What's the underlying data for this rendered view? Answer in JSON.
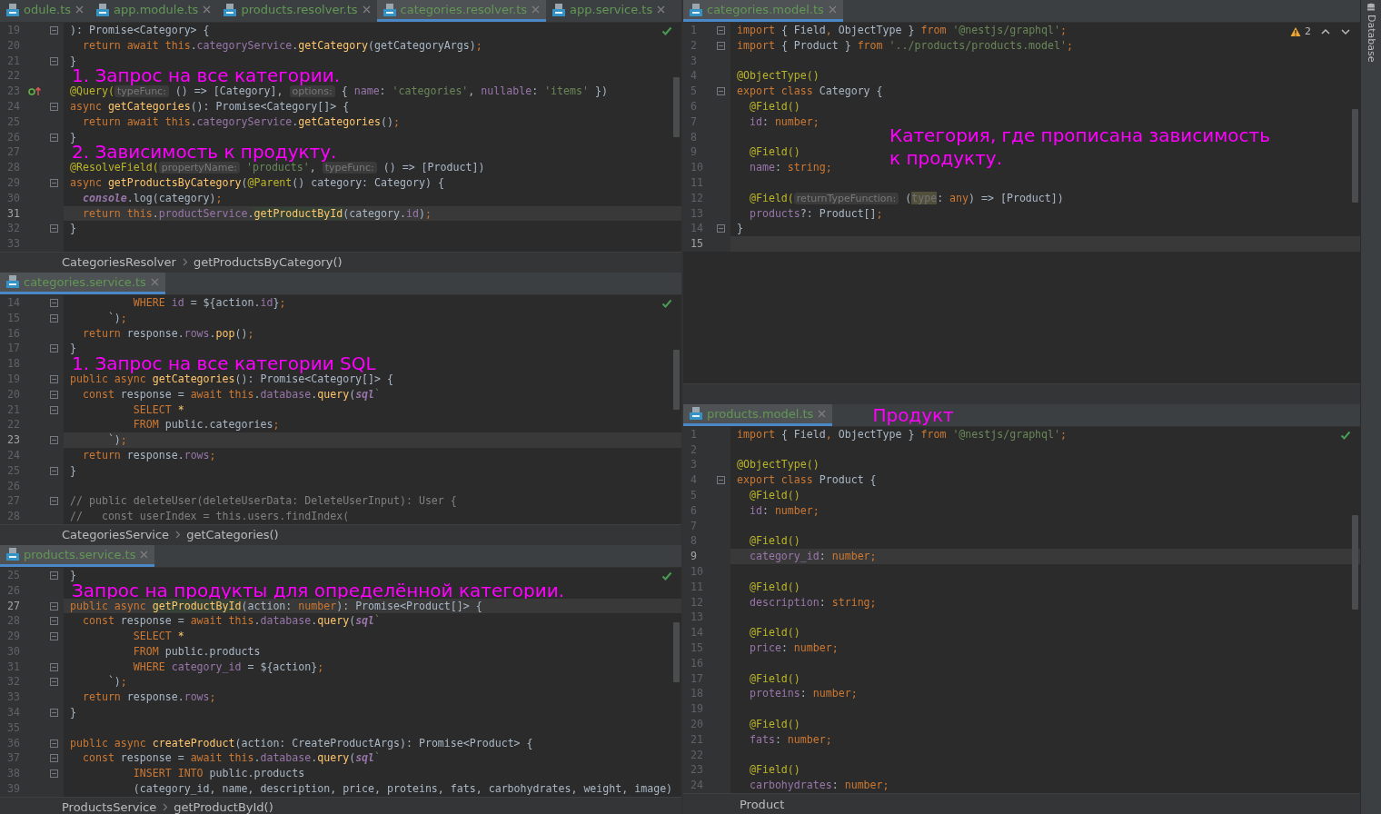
{
  "left_panes": [
    {
      "tabs": [
        {
          "label": "odule.ts",
          "selected": false
        },
        {
          "label": "app.module.ts",
          "selected": false
        },
        {
          "label": "products.resolver.ts",
          "selected": false
        },
        {
          "label": "categories.resolver.ts",
          "selected": true
        },
        {
          "label": "app.service.ts",
          "selected": false
        }
      ],
      "inspection": {
        "kind": "ok"
      },
      "lines": [
        {
          "number": "19",
          "fold": true,
          "current": false,
          "tokens": [
            {
              "text": "): Promise<Category> {",
              "kind": "t"
            }
          ]
        },
        {
          "number": "20",
          "fold": false,
          "current": false,
          "tokens": [
            {
              "text": "  return await this",
              "kind": "k"
            },
            {
              "text": ".",
              "kind": "t"
            },
            {
              "text": "categoryService",
              "kind": "p"
            },
            {
              "text": ".",
              "kind": "t"
            },
            {
              "text": "getCategory",
              "kind": "f"
            },
            {
              "text": "(getCategoryArgs)",
              "kind": "t"
            },
            {
              "text": ";",
              "kind": "k"
            }
          ]
        },
        {
          "number": "21",
          "fold": true,
          "current": false,
          "tokens": [
            {
              "text": "}",
              "kind": "t"
            }
          ]
        },
        {
          "number": "22",
          "fold": false,
          "current": false,
          "note": {
            "text": "1. Запрос на все категории.",
            "kind": "inline"
          }
        },
        {
          "number": "23",
          "fold": false,
          "current": false,
          "gutter_icon": {
            "kind": "implements"
          },
          "tokens": [
            {
              "text": "@Query(",
              "kind": "a"
            },
            {
              "text": "typeFunc:",
              "kind": "h"
            },
            {
              "text": " () => [Category], ",
              "kind": "t"
            },
            {
              "text": "options:",
              "kind": "h"
            },
            {
              "text": " { ",
              "kind": "t"
            },
            {
              "text": "name",
              "kind": "p"
            },
            {
              "text": ": ",
              "kind": "t"
            },
            {
              "text": "'categories'",
              "kind": "s"
            },
            {
              "text": ", ",
              "kind": "t"
            },
            {
              "text": "nullable",
              "kind": "p"
            },
            {
              "text": ": ",
              "kind": "t"
            },
            {
              "text": "'items'",
              "kind": "s"
            },
            {
              "text": " })",
              "kind": "t"
            }
          ]
        },
        {
          "number": "24",
          "fold": true,
          "current": false,
          "tokens": [
            {
              "text": "async ",
              "kind": "k"
            },
            {
              "text": "getCategories",
              "kind": "f"
            },
            {
              "text": "(): Promise<Category[]> {",
              "kind": "t"
            }
          ]
        },
        {
          "number": "25",
          "fold": false,
          "current": false,
          "tokens": [
            {
              "text": "  return await this",
              "kind": "k"
            },
            {
              "text": ".",
              "kind": "t"
            },
            {
              "text": "categoryService",
              "kind": "p"
            },
            {
              "text": ".",
              "kind": "t"
            },
            {
              "text": "getCategories",
              "kind": "f"
            },
            {
              "text": "()",
              "kind": "t"
            },
            {
              "text": ";",
              "kind": "k"
            }
          ]
        },
        {
          "number": "26",
          "fold": true,
          "current": false,
          "tokens": [
            {
              "text": "}",
              "kind": "t"
            }
          ]
        },
        {
          "number": "27",
          "fold": false,
          "current": false,
          "note": {
            "text": "2. Зависимость к продукту.",
            "kind": "inline"
          }
        },
        {
          "number": "28",
          "fold": false,
          "current": false,
          "tokens": [
            {
              "text": "@ResolveField(",
              "kind": "a"
            },
            {
              "text": "propertyName:",
              "kind": "h"
            },
            {
              "text": " 'products'",
              "kind": "s"
            },
            {
              "text": ", ",
              "kind": "t"
            },
            {
              "text": "typeFunc:",
              "kind": "h"
            },
            {
              "text": " () => [Product])",
              "kind": "t"
            }
          ]
        },
        {
          "number": "29",
          "fold": true,
          "current": false,
          "tokens": [
            {
              "text": "async ",
              "kind": "k"
            },
            {
              "text": "getProductsByCategory",
              "kind": "f"
            },
            {
              "text": "(",
              "kind": "t"
            },
            {
              "text": "@Parent",
              "kind": "a"
            },
            {
              "text": "() category: Category) {",
              "kind": "t"
            }
          ]
        },
        {
          "number": "30",
          "fold": false,
          "current": false,
          "tokens": [
            {
              "text": "  console",
              "kind": "i"
            },
            {
              "text": ".log(category)",
              "kind": "t"
            },
            {
              "text": ";",
              "kind": "k"
            }
          ]
        },
        {
          "number": "31",
          "fold": false,
          "current": true,
          "tokens": [
            {
              "text": "  return this",
              "kind": "k"
            },
            {
              "text": ".",
              "kind": "t"
            },
            {
              "text": "productService",
              "kind": "p"
            },
            {
              "text": ".",
              "kind": "t"
            },
            {
              "text": "getProductById",
              "kind": "m"
            },
            {
              "text": "(category.",
              "kind": "t"
            },
            {
              "text": "id",
              "kind": "p"
            },
            {
              "text": ")",
              "kind": "t"
            },
            {
              "text": ";",
              "kind": "k"
            }
          ]
        },
        {
          "number": "32",
          "fold": true,
          "current": false,
          "tokens": [
            {
              "text": "}",
              "kind": "t"
            }
          ]
        },
        {
          "number": "33",
          "fold": false,
          "current": false
        }
      ],
      "breadcrumbs": [
        "CategoriesResolver",
        "getProductsByCategory()"
      ]
    },
    {
      "tabs": [
        {
          "label": "categories.service.ts",
          "selected": true
        }
      ],
      "inspection": {
        "kind": "ok"
      },
      "lines": [
        {
          "number": "14",
          "fold": true,
          "current": false,
          "tokens": [
            {
              "text": "          WHERE ",
              "kind": "k"
            },
            {
              "text": "id",
              "kind": "p"
            },
            {
              "text": " = ${action.",
              "kind": "t"
            },
            {
              "text": "id",
              "kind": "p"
            },
            {
              "text": "}",
              "kind": "t"
            },
            {
              "text": ";",
              "kind": "k"
            }
          ]
        },
        {
          "number": "15",
          "fold": true,
          "current": false,
          "tokens": [
            {
              "text": "      `)",
              "kind": "t"
            },
            {
              "text": ";",
              "kind": "k"
            }
          ]
        },
        {
          "number": "16",
          "fold": false,
          "current": false,
          "tokens": [
            {
              "text": "  return ",
              "kind": "k"
            },
            {
              "text": "response.",
              "kind": "t"
            },
            {
              "text": "rows",
              "kind": "p"
            },
            {
              "text": ".",
              "kind": "t"
            },
            {
              "text": "pop",
              "kind": "f"
            },
            {
              "text": "()",
              "kind": "t"
            },
            {
              "text": ";",
              "kind": "k"
            }
          ]
        },
        {
          "number": "17",
          "fold": true,
          "current": false,
          "tokens": [
            {
              "text": "}",
              "kind": "t"
            }
          ]
        },
        {
          "number": "18",
          "fold": false,
          "current": false,
          "note": {
            "text": "1. Запрос на все категории SQL",
            "kind": "inline"
          }
        },
        {
          "number": "19",
          "fold": true,
          "current": false,
          "tokens": [
            {
              "text": "public async ",
              "kind": "k"
            },
            {
              "text": "getCategories",
              "kind": "f"
            },
            {
              "text": "(): Promise<Category[]> {",
              "kind": "t"
            }
          ]
        },
        {
          "number": "20",
          "fold": true,
          "current": false,
          "tokens": [
            {
              "text": "  const ",
              "kind": "k"
            },
            {
              "text": "response = ",
              "kind": "t"
            },
            {
              "text": "await this",
              "kind": "k"
            },
            {
              "text": ".",
              "kind": "t"
            },
            {
              "text": "database",
              "kind": "p"
            },
            {
              "text": ".",
              "kind": "t"
            },
            {
              "text": "query",
              "kind": "f"
            },
            {
              "text": "(",
              "kind": "t"
            },
            {
              "text": "sql",
              "kind": "i"
            },
            {
              "text": "`",
              "kind": "s"
            }
          ]
        },
        {
          "number": "21",
          "fold": true,
          "current": false,
          "tokens": [
            {
              "text": "          SELECT ",
              "kind": "k"
            },
            {
              "text": "*",
              "kind": "f"
            }
          ]
        },
        {
          "number": "22",
          "fold": false,
          "current": false,
          "tokens": [
            {
              "text": "          FROM ",
              "kind": "k"
            },
            {
              "text": "public.categories",
              "kind": "t"
            },
            {
              "text": ";",
              "kind": "k"
            }
          ]
        },
        {
          "number": "23",
          "fold": true,
          "current": true,
          "tokens": [
            {
              "text": "      `)",
              "kind": "t"
            },
            {
              "text": ";",
              "kind": "k"
            }
          ]
        },
        {
          "number": "24",
          "fold": false,
          "current": false,
          "tokens": [
            {
              "text": "  return ",
              "kind": "k"
            },
            {
              "text": "response.",
              "kind": "t"
            },
            {
              "text": "rows",
              "kind": "p"
            },
            {
              "text": ";",
              "kind": "k"
            }
          ]
        },
        {
          "number": "25",
          "fold": true,
          "current": false,
          "tokens": [
            {
              "text": "}",
              "kind": "t"
            }
          ]
        },
        {
          "number": "26",
          "fold": false,
          "current": false
        },
        {
          "number": "27",
          "fold": true,
          "current": false,
          "tokens": [
            {
              "text": "// public deleteUser(deleteUserData: DeleteUserInput): User {",
              "kind": "c"
            }
          ]
        },
        {
          "number": "28",
          "fold": false,
          "current": false,
          "tokens": [
            {
              "text": "//   const userIndex = this.users.findIndex(",
              "kind": "c"
            }
          ]
        }
      ],
      "breadcrumbs": [
        "CategoriesService",
        "getCategories()"
      ]
    },
    {
      "tabs": [
        {
          "label": "products.service.ts",
          "selected": true
        }
      ],
      "inspection": {
        "kind": "ok"
      },
      "lines": [
        {
          "number": "25",
          "fold": true,
          "current": false,
          "tokens": [
            {
              "text": "}",
              "kind": "t"
            }
          ]
        },
        {
          "number": "26",
          "fold": false,
          "current": false,
          "note": {
            "text": "Запрос на продукты для определённой категории.",
            "kind": "inline"
          }
        },
        {
          "number": "27",
          "fold": true,
          "current": true,
          "tokens": [
            {
              "text": "public async ",
              "kind": "k"
            },
            {
              "text": "getProductById",
              "kind": "m"
            },
            {
              "text": "(action: ",
              "kind": "t"
            },
            {
              "text": "number",
              "kind": "k"
            },
            {
              "text": "): Promise<Product[]> {",
              "kind": "t"
            }
          ]
        },
        {
          "number": "28",
          "fold": true,
          "current": false,
          "tokens": [
            {
              "text": "  const ",
              "kind": "k"
            },
            {
              "text": "response = ",
              "kind": "t"
            },
            {
              "text": "await this",
              "kind": "k"
            },
            {
              "text": ".",
              "kind": "t"
            },
            {
              "text": "database",
              "kind": "p"
            },
            {
              "text": ".",
              "kind": "t"
            },
            {
              "text": "query",
              "kind": "f"
            },
            {
              "text": "(",
              "kind": "t"
            },
            {
              "text": "sql",
              "kind": "i"
            },
            {
              "text": "`",
              "kind": "s"
            }
          ]
        },
        {
          "number": "29",
          "fold": true,
          "current": false,
          "tokens": [
            {
              "text": "          SELECT ",
              "kind": "k"
            },
            {
              "text": "*",
              "kind": "f"
            }
          ]
        },
        {
          "number": "30",
          "fold": false,
          "current": false,
          "tokens": [
            {
              "text": "          FROM ",
              "kind": "k"
            },
            {
              "text": "public.products",
              "kind": "t"
            }
          ]
        },
        {
          "number": "31",
          "fold": true,
          "current": false,
          "tokens": [
            {
              "text": "          WHERE ",
              "kind": "k"
            },
            {
              "text": "category_id",
              "kind": "p"
            },
            {
              "text": " = ${action}",
              "kind": "t"
            },
            {
              "text": ";",
              "kind": "k"
            }
          ]
        },
        {
          "number": "32",
          "fold": true,
          "current": false,
          "tokens": [
            {
              "text": "      `)",
              "kind": "t"
            },
            {
              "text": ";",
              "kind": "k"
            }
          ]
        },
        {
          "number": "33",
          "fold": false,
          "current": false,
          "tokens": [
            {
              "text": "  return ",
              "kind": "k"
            },
            {
              "text": "response.",
              "kind": "t"
            },
            {
              "text": "rows",
              "kind": "p"
            },
            {
              "text": ";",
              "kind": "k"
            }
          ]
        },
        {
          "number": "34",
          "fold": true,
          "current": false,
          "tokens": [
            {
              "text": "}",
              "kind": "t"
            }
          ]
        },
        {
          "number": "35",
          "fold": false,
          "current": false
        },
        {
          "number": "36",
          "fold": true,
          "current": false,
          "tokens": [
            {
              "text": "public async ",
              "kind": "k"
            },
            {
              "text": "createProduct",
              "kind": "f"
            },
            {
              "text": "(action: CreateProductArgs): Promise<Product> {",
              "kind": "t"
            }
          ]
        },
        {
          "number": "37",
          "fold": true,
          "current": false,
          "tokens": [
            {
              "text": "  const ",
              "kind": "k"
            },
            {
              "text": "response = ",
              "kind": "t"
            },
            {
              "text": "await this",
              "kind": "k"
            },
            {
              "text": ".",
              "kind": "t"
            },
            {
              "text": "database",
              "kind": "p"
            },
            {
              "text": ".",
              "kind": "t"
            },
            {
              "text": "query",
              "kind": "f"
            },
            {
              "text": "(",
              "kind": "t"
            },
            {
              "text": "sql",
              "kind": "i"
            },
            {
              "text": "`",
              "kind": "s"
            }
          ]
        },
        {
          "number": "38",
          "fold": true,
          "current": false,
          "tokens": [
            {
              "text": "          INSERT INTO ",
              "kind": "k"
            },
            {
              "text": "public.products",
              "kind": "t"
            }
          ]
        },
        {
          "number": "39",
          "fold": false,
          "current": false,
          "tokens": [
            {
              "text": "          (category_id, name, description, price, proteins, fats, carbohydrates, weight, image)",
              "kind": "t"
            }
          ]
        }
      ],
      "breadcrumbs": [
        "ProductsService",
        "getProductById()"
      ]
    }
  ],
  "right_panes": [
    {
      "tabs": [
        {
          "label": "categories.model.ts",
          "selected": true
        }
      ],
      "inspection": {
        "kind": "warn",
        "count": "2"
      },
      "lines": [
        {
          "number": "1",
          "fold": true,
          "current": false,
          "tokens": [
            {
              "text": "import ",
              "kind": "k"
            },
            {
              "text": "{ Field",
              "kind": "t"
            },
            {
              "text": ", ",
              "kind": "k"
            },
            {
              "text": "ObjectType } ",
              "kind": "t"
            },
            {
              "text": "from ",
              "kind": "k"
            },
            {
              "text": "'@nestjs/graphql'",
              "kind": "s"
            },
            {
              "text": ";",
              "kind": "k"
            }
          ]
        },
        {
          "number": "2",
          "fold": true,
          "current": false,
          "tokens": [
            {
              "text": "import ",
              "kind": "k"
            },
            {
              "text": "{ Product } ",
              "kind": "t"
            },
            {
              "text": "from ",
              "kind": "k"
            },
            {
              "text": "'../products/products.model'",
              "kind": "s"
            },
            {
              "text": ";",
              "kind": "k"
            }
          ]
        },
        {
          "number": "3",
          "fold": false,
          "current": false
        },
        {
          "number": "4",
          "fold": false,
          "current": false,
          "tokens": [
            {
              "text": "@ObjectType()",
              "kind": "a"
            }
          ]
        },
        {
          "number": "5",
          "fold": true,
          "current": false,
          "tokens": [
            {
              "text": "export class ",
              "kind": "k"
            },
            {
              "text": "Category {",
              "kind": "t"
            }
          ]
        },
        {
          "number": "6",
          "fold": false,
          "current": false,
          "tokens": [
            {
              "text": "  @Field()",
              "kind": "a"
            }
          ]
        },
        {
          "number": "7",
          "fold": false,
          "current": false,
          "tokens": [
            {
              "text": "  id",
              "kind": "p"
            },
            {
              "text": ": ",
              "kind": "t"
            },
            {
              "text": "number;",
              "kind": "k"
            }
          ]
        },
        {
          "number": "8",
          "fold": false,
          "current": false,
          "note": {
            "text": "Категория, где прописана зависимость\nк продукту.",
            "kind": "aside"
          }
        },
        {
          "number": "9",
          "fold": false,
          "current": false,
          "tokens": [
            {
              "text": "  @Field()",
              "kind": "a"
            }
          ]
        },
        {
          "number": "10",
          "fold": false,
          "current": false,
          "tokens": [
            {
              "text": "  name",
              "kind": "p"
            },
            {
              "text": ": ",
              "kind": "t"
            },
            {
              "text": "string;",
              "kind": "k"
            }
          ]
        },
        {
          "number": "11",
          "fold": false,
          "current": false
        },
        {
          "number": "12",
          "fold": false,
          "current": false,
          "tokens": [
            {
              "text": "  @Field(",
              "kind": "a"
            },
            {
              "text": "returnTypeFunction:",
              "kind": "h"
            },
            {
              "text": " (",
              "kind": "t"
            },
            {
              "text": "type",
              "kind": "u"
            },
            {
              "text": ": ",
              "kind": "t"
            },
            {
              "text": "any",
              "kind": "k"
            },
            {
              "text": ") => [Product])",
              "kind": "t"
            }
          ]
        },
        {
          "number": "13",
          "fold": false,
          "current": false,
          "tokens": [
            {
              "text": "  products",
              "kind": "p"
            },
            {
              "text": "?: Product[]",
              "kind": "t"
            },
            {
              "text": ";",
              "kind": "k"
            }
          ]
        },
        {
          "number": "14",
          "fold": true,
          "current": false,
          "tokens": [
            {
              "text": "}",
              "kind": "t"
            }
          ]
        },
        {
          "number": "15",
          "fold": false,
          "current": true
        }
      ]
    },
    {
      "tabs": [
        {
          "label": "products.model.ts",
          "selected": true
        }
      ],
      "note": "Продукт",
      "inspection": {
        "kind": "ok"
      },
      "lines": [
        {
          "number": "1",
          "fold": false,
          "current": false,
          "tokens": [
            {
              "text": "import ",
              "kind": "k"
            },
            {
              "text": "{ Field",
              "kind": "t"
            },
            {
              "text": ", ",
              "kind": "k"
            },
            {
              "text": "ObjectType } ",
              "kind": "t"
            },
            {
              "text": "from ",
              "kind": "k"
            },
            {
              "text": "'@nestjs/graphql'",
              "kind": "s"
            },
            {
              "text": ";",
              "kind": "k"
            }
          ]
        },
        {
          "number": "2",
          "fold": false,
          "current": false
        },
        {
          "number": "3",
          "fold": false,
          "current": false,
          "tokens": [
            {
              "text": "@ObjectType()",
              "kind": "a"
            }
          ]
        },
        {
          "number": "4",
          "fold": true,
          "current": false,
          "tokens": [
            {
              "text": "export class ",
              "kind": "k"
            },
            {
              "text": "Product {",
              "kind": "t"
            }
          ]
        },
        {
          "number": "5",
          "fold": false,
          "current": false,
          "tokens": [
            {
              "text": "  @Field()",
              "kind": "a"
            }
          ]
        },
        {
          "number": "6",
          "fold": false,
          "current": false,
          "tokens": [
            {
              "text": "  id",
              "kind": "p"
            },
            {
              "text": ": ",
              "kind": "t"
            },
            {
              "text": "number;",
              "kind": "k"
            }
          ]
        },
        {
          "number": "7",
          "fold": false,
          "current": false
        },
        {
          "number": "8",
          "fold": false,
          "current": false,
          "tokens": [
            {
              "text": "  @Field()",
              "kind": "a"
            }
          ]
        },
        {
          "number": "9",
          "fold": false,
          "current": true,
          "tokens": [
            {
              "text": "  category_id",
              "kind": "p"
            },
            {
              "text": ": ",
              "kind": "t"
            },
            {
              "text": "number;",
              "kind": "k"
            }
          ]
        },
        {
          "number": "10",
          "fold": false,
          "current": false
        },
        {
          "number": "11",
          "fold": false,
          "current": false,
          "tokens": [
            {
              "text": "  @Field()",
              "kind": "a"
            }
          ]
        },
        {
          "number": "12",
          "fold": false,
          "current": false,
          "tokens": [
            {
              "text": "  description",
              "kind": "p"
            },
            {
              "text": ": ",
              "kind": "t"
            },
            {
              "text": "string;",
              "kind": "k"
            }
          ]
        },
        {
          "number": "13",
          "fold": false,
          "current": false
        },
        {
          "number": "14",
          "fold": false,
          "current": false,
          "tokens": [
            {
              "text": "  @Field()",
              "kind": "a"
            }
          ]
        },
        {
          "number": "15",
          "fold": false,
          "current": false,
          "tokens": [
            {
              "text": "  price",
              "kind": "p"
            },
            {
              "text": ": ",
              "kind": "t"
            },
            {
              "text": "number;",
              "kind": "k"
            }
          ]
        },
        {
          "number": "16",
          "fold": false,
          "current": false
        },
        {
          "number": "17",
          "fold": false,
          "current": false,
          "tokens": [
            {
              "text": "  @Field()",
              "kind": "a"
            }
          ]
        },
        {
          "number": "18",
          "fold": false,
          "current": false,
          "tokens": [
            {
              "text": "  proteins",
              "kind": "p"
            },
            {
              "text": ": ",
              "kind": "t"
            },
            {
              "text": "number;",
              "kind": "k"
            }
          ]
        },
        {
          "number": "19",
          "fold": false,
          "current": false
        },
        {
          "number": "20",
          "fold": false,
          "current": false,
          "tokens": [
            {
              "text": "  @Field()",
              "kind": "a"
            }
          ]
        },
        {
          "number": "21",
          "fold": false,
          "current": false,
          "tokens": [
            {
              "text": "  fats",
              "kind": "p"
            },
            {
              "text": ": ",
              "kind": "t"
            },
            {
              "text": "number;",
              "kind": "k"
            }
          ]
        },
        {
          "number": "22",
          "fold": false,
          "current": false
        },
        {
          "number": "23",
          "fold": false,
          "current": false,
          "tokens": [
            {
              "text": "  @Field()",
              "kind": "a"
            }
          ]
        },
        {
          "number": "24",
          "fold": false,
          "current": false,
          "tokens": [
            {
              "text": "  carbohydrates",
              "kind": "p"
            },
            {
              "text": ": ",
              "kind": "t"
            },
            {
              "text": "number;",
              "kind": "k"
            }
          ]
        }
      ],
      "breadcrumbs": [
        "Product"
      ]
    }
  ],
  "tool_strip": {
    "label": "Database"
  }
}
